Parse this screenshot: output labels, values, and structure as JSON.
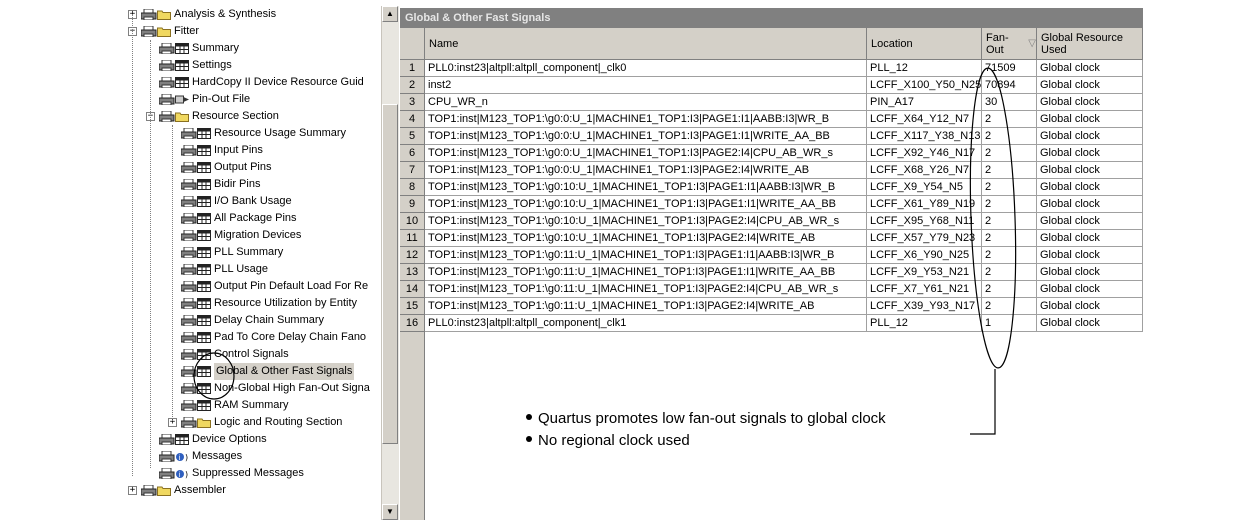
{
  "tree": {
    "items": [
      {
        "label": "Analysis & Synthesis",
        "indent": 0,
        "expander": "+",
        "icon": "folder"
      },
      {
        "label": "Fitter",
        "indent": 0,
        "expander": "−",
        "icon": "folder-open"
      },
      {
        "label": "Summary",
        "indent": 1,
        "icon": "table"
      },
      {
        "label": "Settings",
        "indent": 1,
        "icon": "table"
      },
      {
        "label": "HardCopy II Device Resource Guid",
        "indent": 1,
        "icon": "table"
      },
      {
        "label": "Pin-Out File",
        "indent": 1,
        "icon": "file"
      },
      {
        "label": "Resource Section",
        "indent": 1,
        "expander": "−",
        "icon": "folder-open"
      },
      {
        "label": "Resource Usage Summary",
        "indent": 2,
        "icon": "table"
      },
      {
        "label": "Input Pins",
        "indent": 2,
        "icon": "table"
      },
      {
        "label": "Output Pins",
        "indent": 2,
        "icon": "table"
      },
      {
        "label": "Bidir Pins",
        "indent": 2,
        "icon": "table"
      },
      {
        "label": "I/O Bank Usage",
        "indent": 2,
        "icon": "table"
      },
      {
        "label": "All Package Pins",
        "indent": 2,
        "icon": "table"
      },
      {
        "label": "Migration Devices",
        "indent": 2,
        "icon": "table"
      },
      {
        "label": "PLL Summary",
        "indent": 2,
        "icon": "table"
      },
      {
        "label": "PLL Usage",
        "indent": 2,
        "icon": "table"
      },
      {
        "label": "Output Pin Default Load For Re",
        "indent": 2,
        "icon": "table"
      },
      {
        "label": "Resource Utilization by Entity",
        "indent": 2,
        "icon": "table"
      },
      {
        "label": "Delay Chain Summary",
        "indent": 2,
        "icon": "table"
      },
      {
        "label": "Pad To Core Delay Chain Fano",
        "indent": 2,
        "icon": "table"
      },
      {
        "label": "Control Signals",
        "indent": 2,
        "icon": "table"
      },
      {
        "label": "Global & Other Fast Signals",
        "indent": 2,
        "icon": "table",
        "selected": true
      },
      {
        "label": "Non-Global High Fan-Out Signa",
        "indent": 2,
        "icon": "table"
      },
      {
        "label": "RAM Summary",
        "indent": 2,
        "icon": "table"
      },
      {
        "label": "Logic and Routing Section",
        "indent": 2,
        "expander": "+",
        "icon": "folder"
      },
      {
        "label": "Device Options",
        "indent": 1,
        "icon": "table"
      },
      {
        "label": "Messages",
        "indent": 1,
        "icon": "info"
      },
      {
        "label": "Suppressed Messages",
        "indent": 1,
        "icon": "info"
      },
      {
        "label": "Assembler",
        "indent": 0,
        "expander": "+",
        "icon": "folder"
      }
    ]
  },
  "table": {
    "title": "Global & Other Fast Signals",
    "headers": {
      "name": "Name",
      "location": "Location",
      "fanout": "Fan-Out",
      "resource": "Global Resource Used"
    },
    "sort_indicator": "▽",
    "rows": [
      {
        "n": "1",
        "name": "PLL0:inst23|altpll:altpll_component|_clk0",
        "location": "PLL_12",
        "fanout": "71509",
        "resource": "Global clock"
      },
      {
        "n": "2",
        "name": "inst2",
        "location": "LCFF_X100_Y50_N25",
        "fanout": "70894",
        "resource": "Global clock"
      },
      {
        "n": "3",
        "name": "CPU_WR_n",
        "location": "PIN_A17",
        "fanout": "30",
        "resource": "Global clock"
      },
      {
        "n": "4",
        "name": "TOP1:inst|M123_TOP1:\\g0:0:U_1|MACHINE1_TOP1:I3|PAGE1:I1|AABB:I3|WR_B",
        "location": "LCFF_X64_Y12_N7",
        "fanout": "2",
        "resource": "Global clock"
      },
      {
        "n": "5",
        "name": "TOP1:inst|M123_TOP1:\\g0:0:U_1|MACHINE1_TOP1:I3|PAGE1:I1|WRITE_AA_BB",
        "location": "LCFF_X117_Y38_N13",
        "fanout": "2",
        "resource": "Global clock"
      },
      {
        "n": "6",
        "name": "TOP1:inst|M123_TOP1:\\g0:0:U_1|MACHINE1_TOP1:I3|PAGE2:I4|CPU_AB_WR_s",
        "location": "LCFF_X92_Y46_N17",
        "fanout": "2",
        "resource": "Global clock"
      },
      {
        "n": "7",
        "name": "TOP1:inst|M123_TOP1:\\g0:0:U_1|MACHINE1_TOP1:I3|PAGE2:I4|WRITE_AB",
        "location": "LCFF_X68_Y26_N7",
        "fanout": "2",
        "resource": "Global clock"
      },
      {
        "n": "8",
        "name": "TOP1:inst|M123_TOP1:\\g0:10:U_1|MACHINE1_TOP1:I3|PAGE1:I1|AABB:I3|WR_B",
        "location": "LCFF_X9_Y54_N5",
        "fanout": "2",
        "resource": "Global clock"
      },
      {
        "n": "9",
        "name": "TOP1:inst|M123_TOP1:\\g0:10:U_1|MACHINE1_TOP1:I3|PAGE1:I1|WRITE_AA_BB",
        "location": "LCFF_X61_Y89_N19",
        "fanout": "2",
        "resource": "Global clock"
      },
      {
        "n": "10",
        "name": "TOP1:inst|M123_TOP1:\\g0:10:U_1|MACHINE1_TOP1:I3|PAGE2:I4|CPU_AB_WR_s",
        "location": "LCFF_X95_Y68_N11",
        "fanout": "2",
        "resource": "Global clock"
      },
      {
        "n": "11",
        "name": "TOP1:inst|M123_TOP1:\\g0:10:U_1|MACHINE1_TOP1:I3|PAGE2:I4|WRITE_AB",
        "location": "LCFF_X57_Y79_N23",
        "fanout": "2",
        "resource": "Global clock"
      },
      {
        "n": "12",
        "name": "TOP1:inst|M123_TOP1:\\g0:11:U_1|MACHINE1_TOP1:I3|PAGE1:I1|AABB:I3|WR_B",
        "location": "LCFF_X6_Y90_N25",
        "fanout": "2",
        "resource": "Global clock"
      },
      {
        "n": "13",
        "name": "TOP1:inst|M123_TOP1:\\g0:11:U_1|MACHINE1_TOP1:I3|PAGE1:I1|WRITE_AA_BB",
        "location": "LCFF_X9_Y53_N21",
        "fanout": "2",
        "resource": "Global clock"
      },
      {
        "n": "14",
        "name": "TOP1:inst|M123_TOP1:\\g0:11:U_1|MACHINE1_TOP1:I3|PAGE2:I4|CPU_AB_WR_s",
        "location": "LCFF_X7_Y61_N21",
        "fanout": "2",
        "resource": "Global clock"
      },
      {
        "n": "15",
        "name": "TOP1:inst|M123_TOP1:\\g0:11:U_1|MACHINE1_TOP1:I3|PAGE2:I4|WRITE_AB",
        "location": "LCFF_X39_Y93_N17",
        "fanout": "2",
        "resource": "Global clock"
      },
      {
        "n": "16",
        "name": "PLL0:inst23|altpll:altpll_component|_clk1",
        "location": "PLL_12",
        "fanout": "1",
        "resource": "Global clock"
      }
    ]
  },
  "annotation": {
    "bullet1": "Quartus promotes low fan-out signals to global clock",
    "bullet2": "No regional clock used"
  },
  "colors": {
    "panel_gray": "#d4d0c8",
    "title_bar": "#808080",
    "selection": "#d4d0c8",
    "annotation": "#000000"
  }
}
